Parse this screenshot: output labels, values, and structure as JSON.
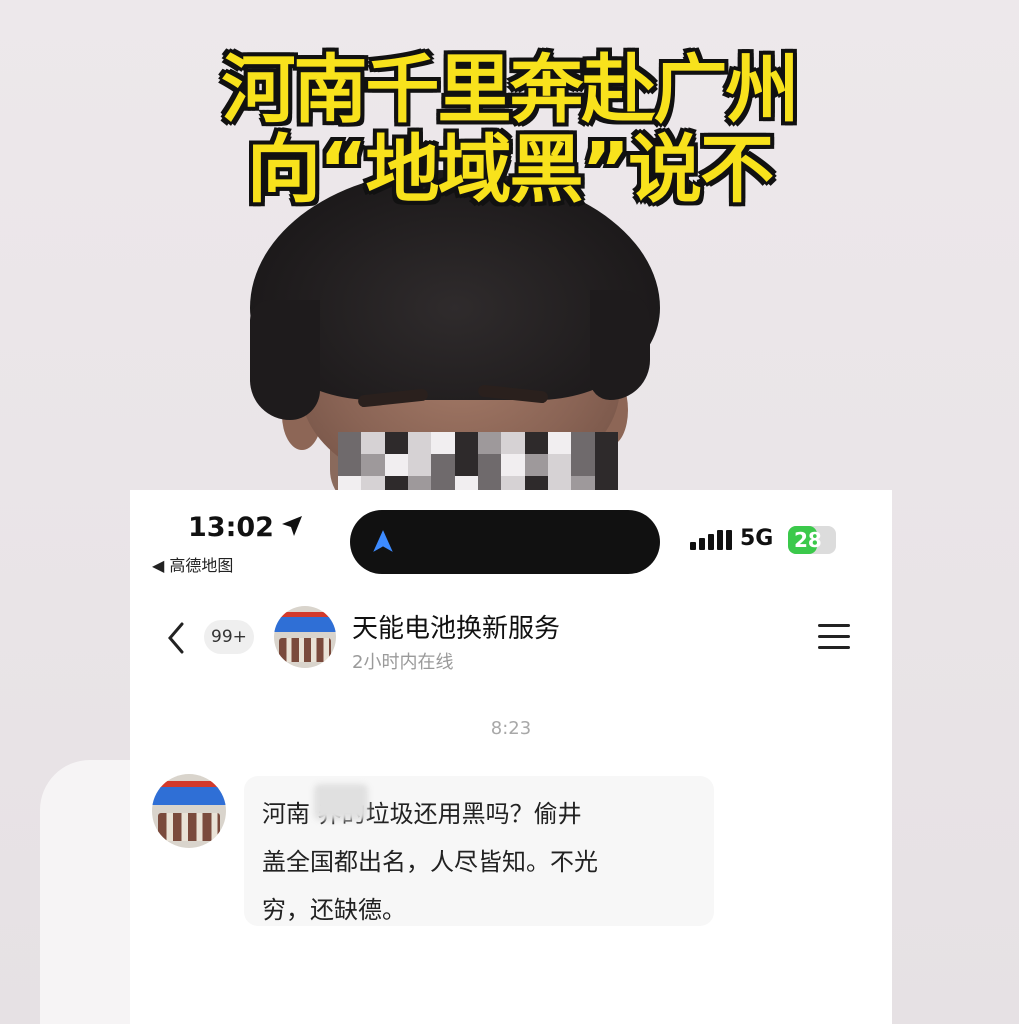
{
  "headline": {
    "line1": "河南千里奔赴广州",
    "line2": "向“地域黑”说不"
  },
  "status_bar": {
    "time": "13:02",
    "back_app": "◀ 高德地图",
    "network": "5G",
    "battery_percent": "28",
    "battery_level": 0.28,
    "battery_color": "#3bc94b"
  },
  "chat_header": {
    "unread_count": "99+",
    "title": "天能电池换新服务",
    "subtitle": "2小时内在线"
  },
  "conversation": {
    "timestamp": "8:23",
    "message": {
      "line1": "河南  养的垃圾还用黑吗？偷井",
      "line2": "盖全国都出名，人尽皆知。不光",
      "line3": "穷，还缺德。"
    }
  },
  "colors": {
    "headline_fill": "#f8e21c",
    "headline_outline": "#111111",
    "accent_blue": "#2f6fd6"
  },
  "icons": [
    "location-arrow-icon",
    "navigation-icon",
    "back-chevron-icon",
    "menu-icon",
    "signal-icon",
    "battery-icon"
  ]
}
